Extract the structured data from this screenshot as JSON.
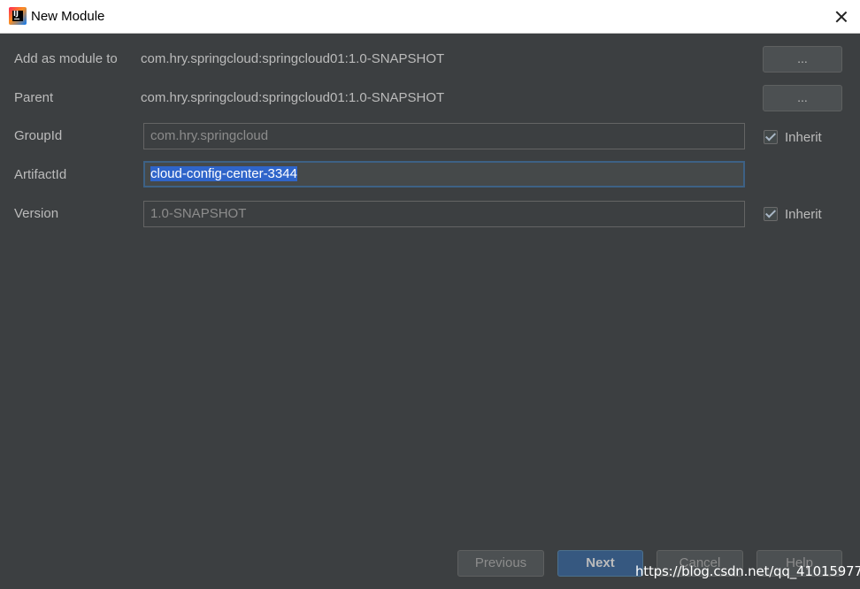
{
  "window": {
    "title": "New Module",
    "icon": "intellij-idea-icon",
    "icon_glyph": "IJ"
  },
  "form": {
    "add_as_module_to": {
      "label": "Add as module to",
      "value": "com.hry.springcloud:springcloud01:1.0-SNAPSHOT",
      "button_label": "..."
    },
    "parent": {
      "label": "Parent",
      "value": "com.hry.springcloud:springcloud01:1.0-SNAPSHOT",
      "button_label": "..."
    },
    "group_id": {
      "label": "GroupId",
      "value": "com.hry.springcloud",
      "inherit_label": "Inherit",
      "inherit_checked": true
    },
    "artifact_id": {
      "label": "ArtifactId",
      "value": "cloud-config-center-3344"
    },
    "version": {
      "label": "Version",
      "value": "1.0-SNAPSHOT",
      "inherit_label": "Inherit",
      "inherit_checked": true
    }
  },
  "footer": {
    "previous_label": "Previous",
    "next_label": "Next",
    "cancel_label": "Cancel",
    "help_label": "Help"
  },
  "watermark": "https://blog.csdn.net/qq_41015977",
  "colors": {
    "background": "#3c3f41",
    "primary_button": "#365880",
    "selection": "#2f65ca"
  }
}
